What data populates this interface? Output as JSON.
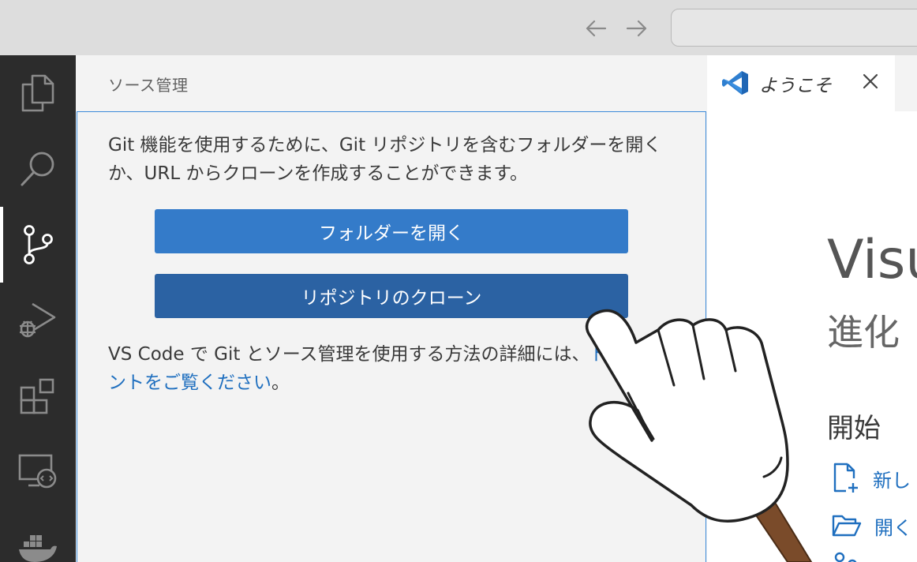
{
  "titlebar": {
    "back_icon": "arrow-left-icon",
    "forward_icon": "arrow-right-icon"
  },
  "activitybar": {
    "items": [
      {
        "name": "explorer",
        "icon": "files-icon",
        "active": false
      },
      {
        "name": "search",
        "icon": "search-icon",
        "active": false
      },
      {
        "name": "source-control",
        "icon": "source-control-icon",
        "active": true
      },
      {
        "name": "run-debug",
        "icon": "run-debug-icon",
        "active": false
      },
      {
        "name": "extensions",
        "icon": "extensions-icon",
        "active": false
      },
      {
        "name": "remote-explorer",
        "icon": "remote-explorer-icon",
        "active": false
      },
      {
        "name": "docker",
        "icon": "docker-icon",
        "active": false
      }
    ]
  },
  "sidebar": {
    "title": "ソース管理",
    "message": "Git 機能を使用するために、Git リポジトリを含むフォルダーを開くか、URL からクローンを作成することができます。",
    "open_folder_label": "フォルダーを開く",
    "clone_label": "リポジトリのクローン",
    "docs_prefix": "VS Code で Git とソース管理を使用する方法の詳細には、",
    "docs_link": "ドキュメントをご覧ください",
    "docs_suffix": "。"
  },
  "editor": {
    "tab": {
      "label": "ようこそ",
      "icon": "vscode-logo-icon",
      "close_icon": "close-icon"
    },
    "welcome": {
      "title": "Visu",
      "subtitle": "進化",
      "start_heading": "開始",
      "start_items": [
        {
          "icon": "new-file-icon",
          "label": "新し"
        },
        {
          "icon": "folder-open-icon",
          "label": "開く"
        },
        {
          "icon": "source-control-icon",
          "label": ""
        }
      ]
    }
  },
  "overlay": {
    "icon": "pointing-hand-icon"
  },
  "colors": {
    "accent": "#347bc9",
    "button_pressed": "#2b62a3",
    "link": "#1f6fbf",
    "activitybar": "#2c2c2c",
    "focus_border": "#3c8ad9"
  }
}
